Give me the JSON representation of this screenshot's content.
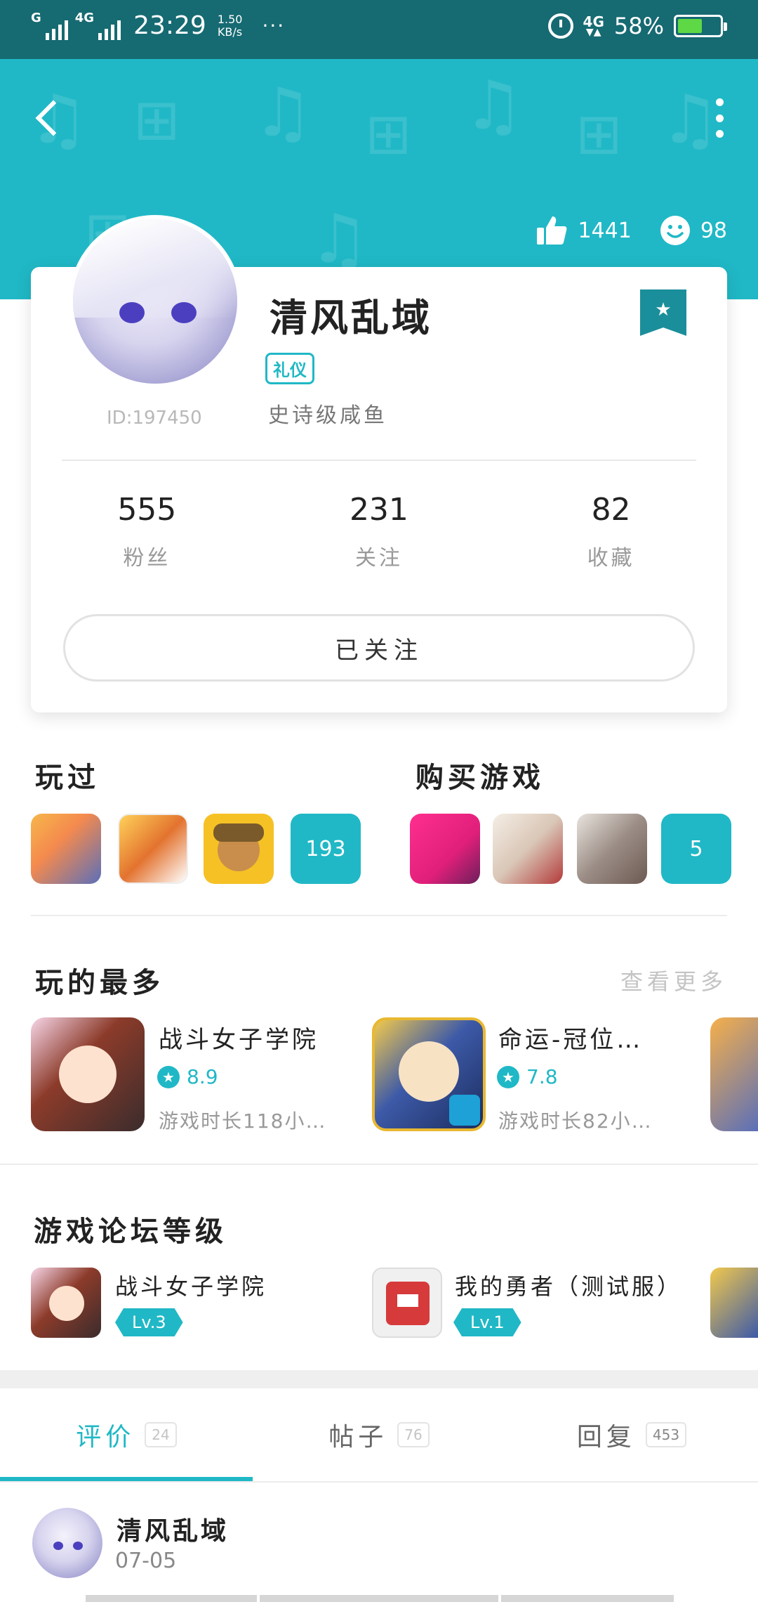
{
  "status_bar": {
    "network_left": "G",
    "network_right": "4G",
    "time": "23:29",
    "speed_value": "1.50",
    "speed_unit": "KB/s",
    "more": "···",
    "network_4g": "4G",
    "battery_percent": "58%",
    "battery_level": 0.58
  },
  "header": {
    "likes": "1441",
    "smiles": "98",
    "background_color": "#20b8c6"
  },
  "profile": {
    "username": "清风乱域",
    "tag": "礼仪",
    "title": "史诗级咸鱼",
    "id": "ID:197450",
    "stats": [
      {
        "value": "555",
        "label": "粉丝"
      },
      {
        "value": "231",
        "label": "关注"
      },
      {
        "value": "82",
        "label": "收藏"
      }
    ],
    "follow_button": "已关注"
  },
  "played": {
    "title": "玩过",
    "icons": [
      "game-icon-1",
      "game-icon-2",
      "game-icon-3"
    ],
    "count": "193"
  },
  "purchased": {
    "title": "购买游戏",
    "icons": [
      "game-icon-1",
      "game-icon-2",
      "game-icon-3"
    ],
    "count": "5"
  },
  "most_played": {
    "title": "玩的最多",
    "more": "查看更多",
    "items": [
      {
        "name": "战斗女子学院",
        "score": "8.9",
        "time": "游戏时长118小…"
      },
      {
        "name": "命运-冠位…",
        "score": "7.8",
        "time": "游戏时长82小…"
      }
    ]
  },
  "forum_level": {
    "title": "游戏论坛等级",
    "items": [
      {
        "name": "战斗女子学院",
        "level": "Lv.3"
      },
      {
        "name": "我的勇者（测试服）",
        "level": "Lv.1"
      }
    ]
  },
  "tabs": [
    {
      "label": "评价",
      "count": "24",
      "active": true
    },
    {
      "label": "帖子",
      "count": "76",
      "active": false
    },
    {
      "label": "回复",
      "count": "453",
      "active": false
    }
  ],
  "post": {
    "author": "清风乱域",
    "date": "07-05"
  },
  "colors": {
    "accent": "#20b8c6",
    "status_bar": "#166a72"
  }
}
